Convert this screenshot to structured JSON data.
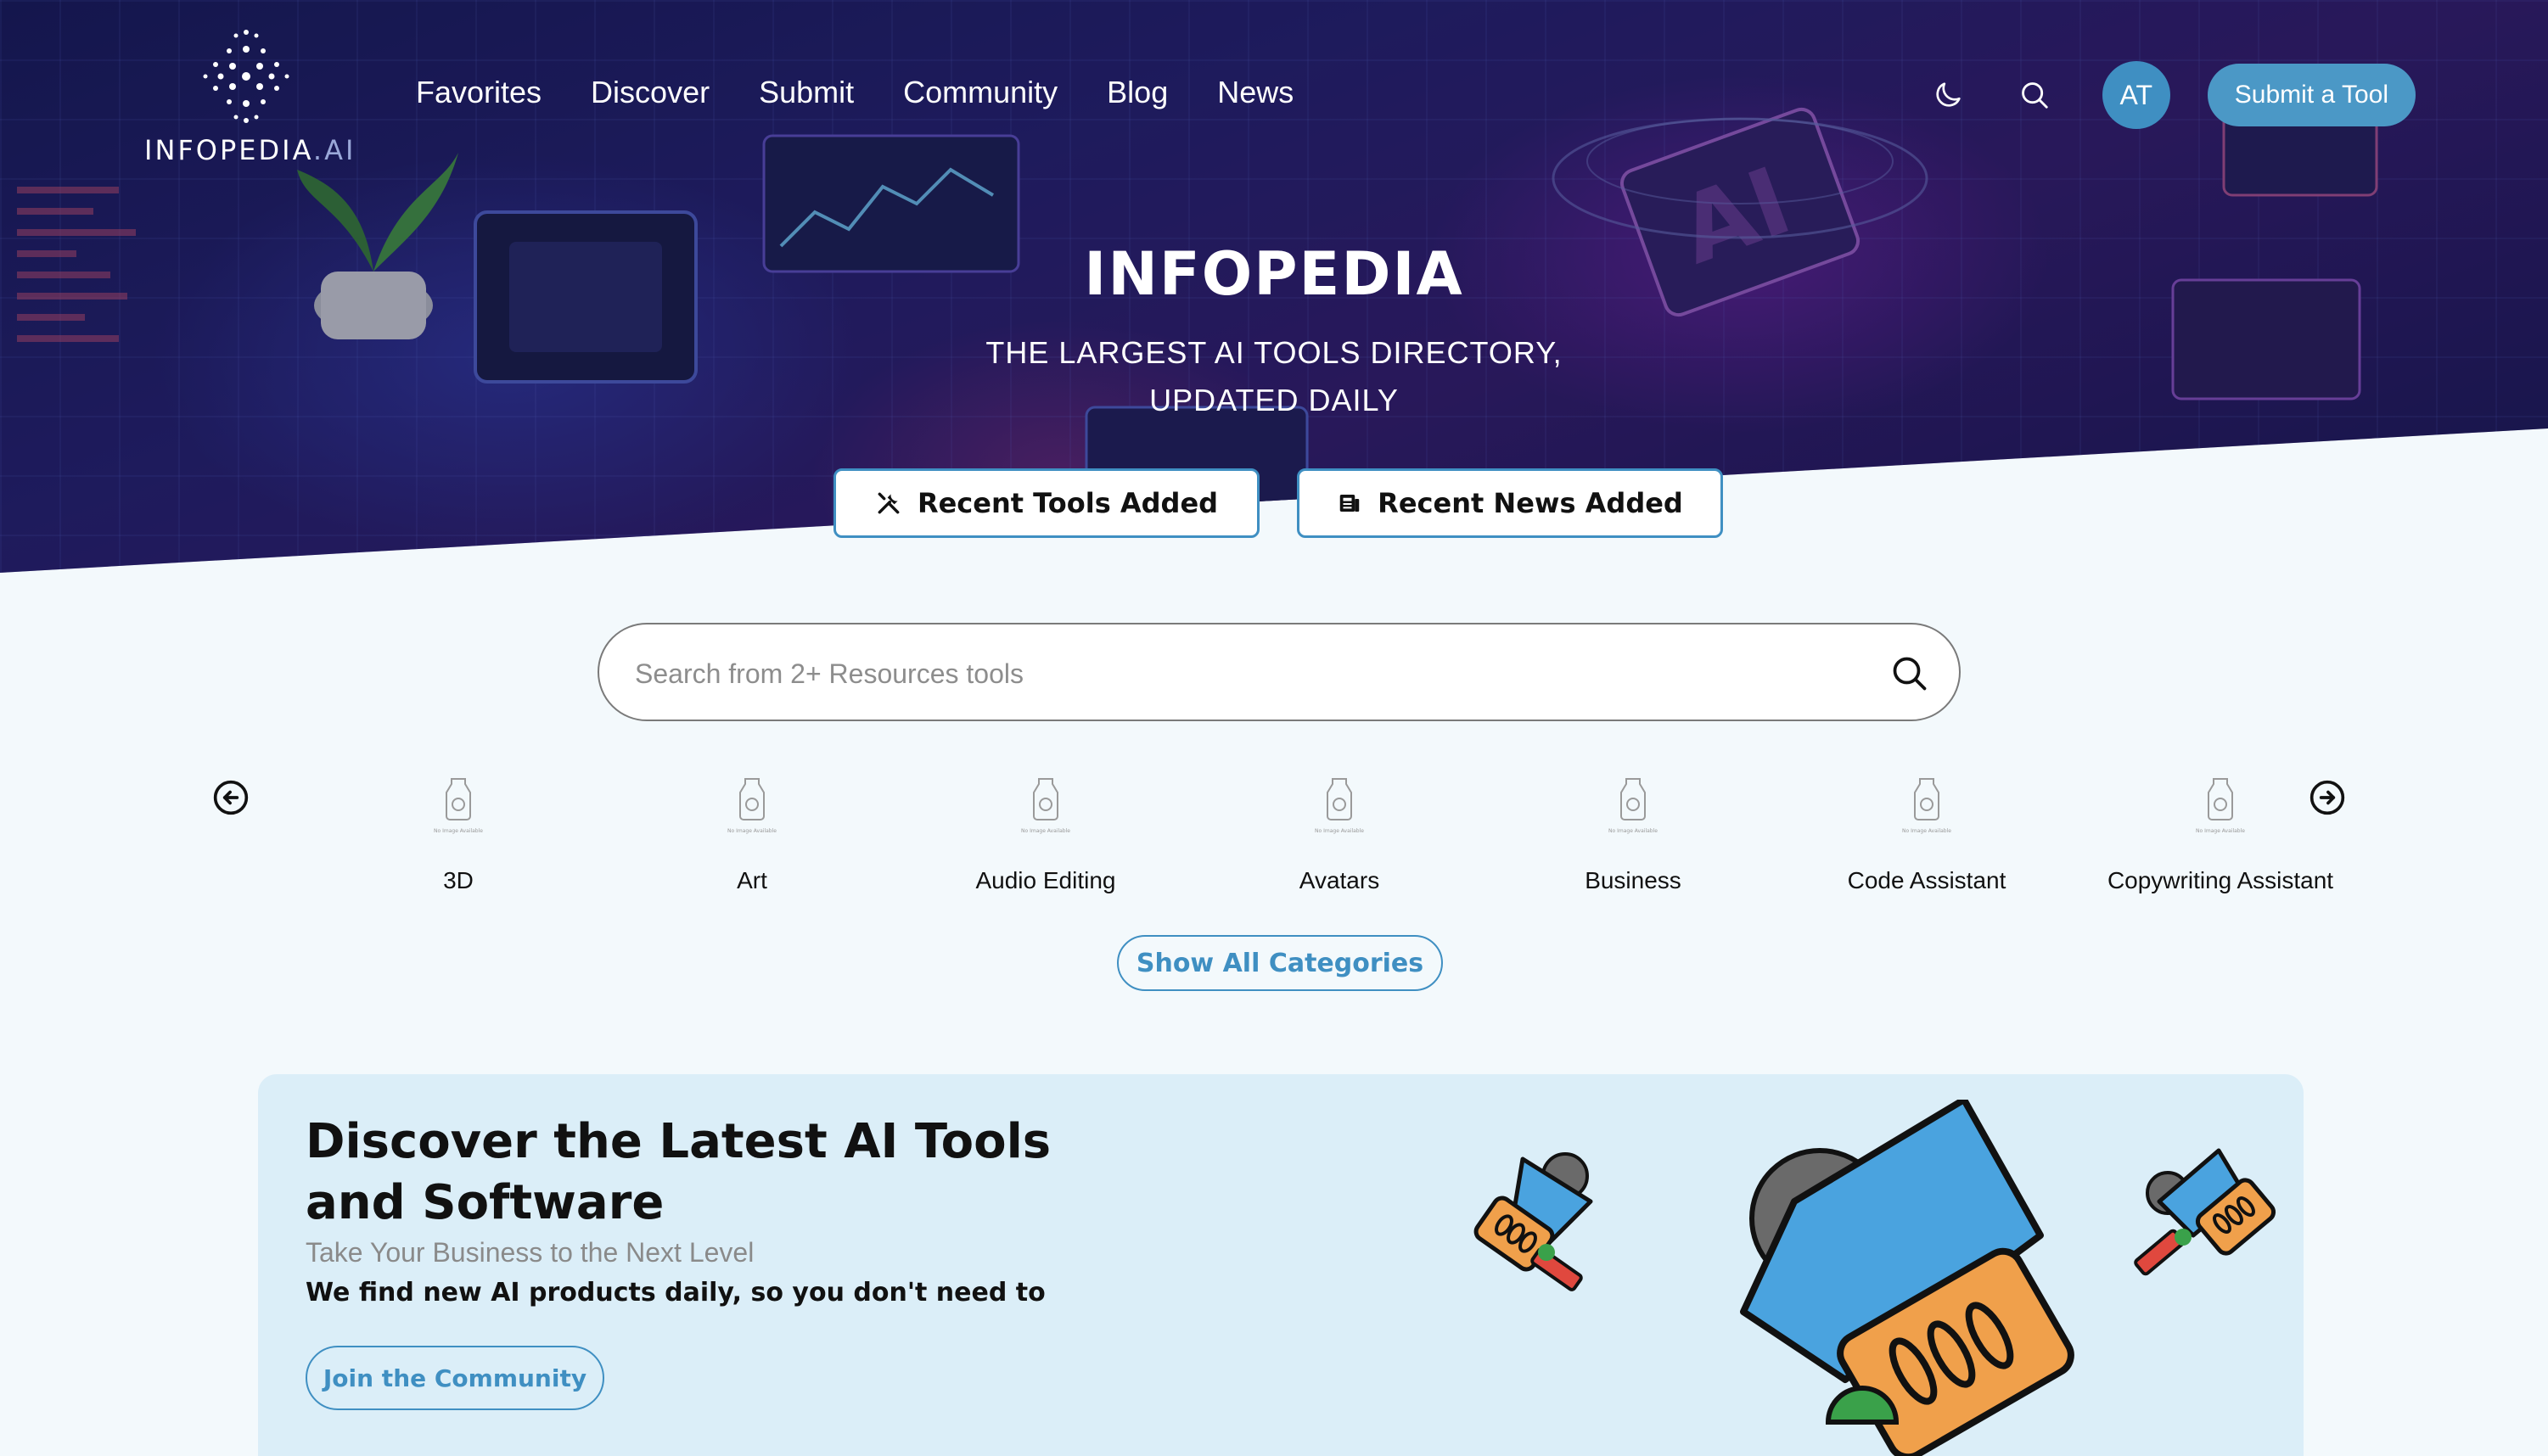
{
  "brand": {
    "logo_text": "INFOPEDIA",
    "logo_suffix": ".AI"
  },
  "nav": {
    "links": [
      "Favorites",
      "Discover",
      "Submit",
      "Community",
      "Blog",
      "News"
    ],
    "avatar_initials": "AT",
    "submit_button": "Submit a Tool",
    "icons": [
      "moon-icon",
      "search-icon"
    ]
  },
  "hero": {
    "title": "INFOPEDIA",
    "subtitle_line1": "THE LARGEST AI TOOLS DIRECTORY,",
    "subtitle_line2": "UPDATED DAILY",
    "recent_tools_button": "Recent Tools Added",
    "recent_news_button": "Recent News Added"
  },
  "search": {
    "placeholder": "Search from 2+ Resources tools"
  },
  "categories": {
    "items": [
      "3D",
      "Art",
      "Audio Editing",
      "Avatars",
      "Business",
      "Code Assistant",
      "Copywriting Assistant"
    ],
    "image_placeholder_text": "No Image Available",
    "show_all": "Show All Categories"
  },
  "promo": {
    "title": "Discover the Latest AI Tools and Software",
    "subtitle": "Take Your Business to the Next Level",
    "description": "We find new AI products daily, so you don't need to",
    "join_button": "Join the Community"
  },
  "colors": {
    "accent": "#3f8fc2",
    "page_bg": "#f3f9fc",
    "promo_bg": "#dbeef8",
    "megaphone_blue": "#4aa3df",
    "megaphone_orange": "#f0a04b"
  }
}
